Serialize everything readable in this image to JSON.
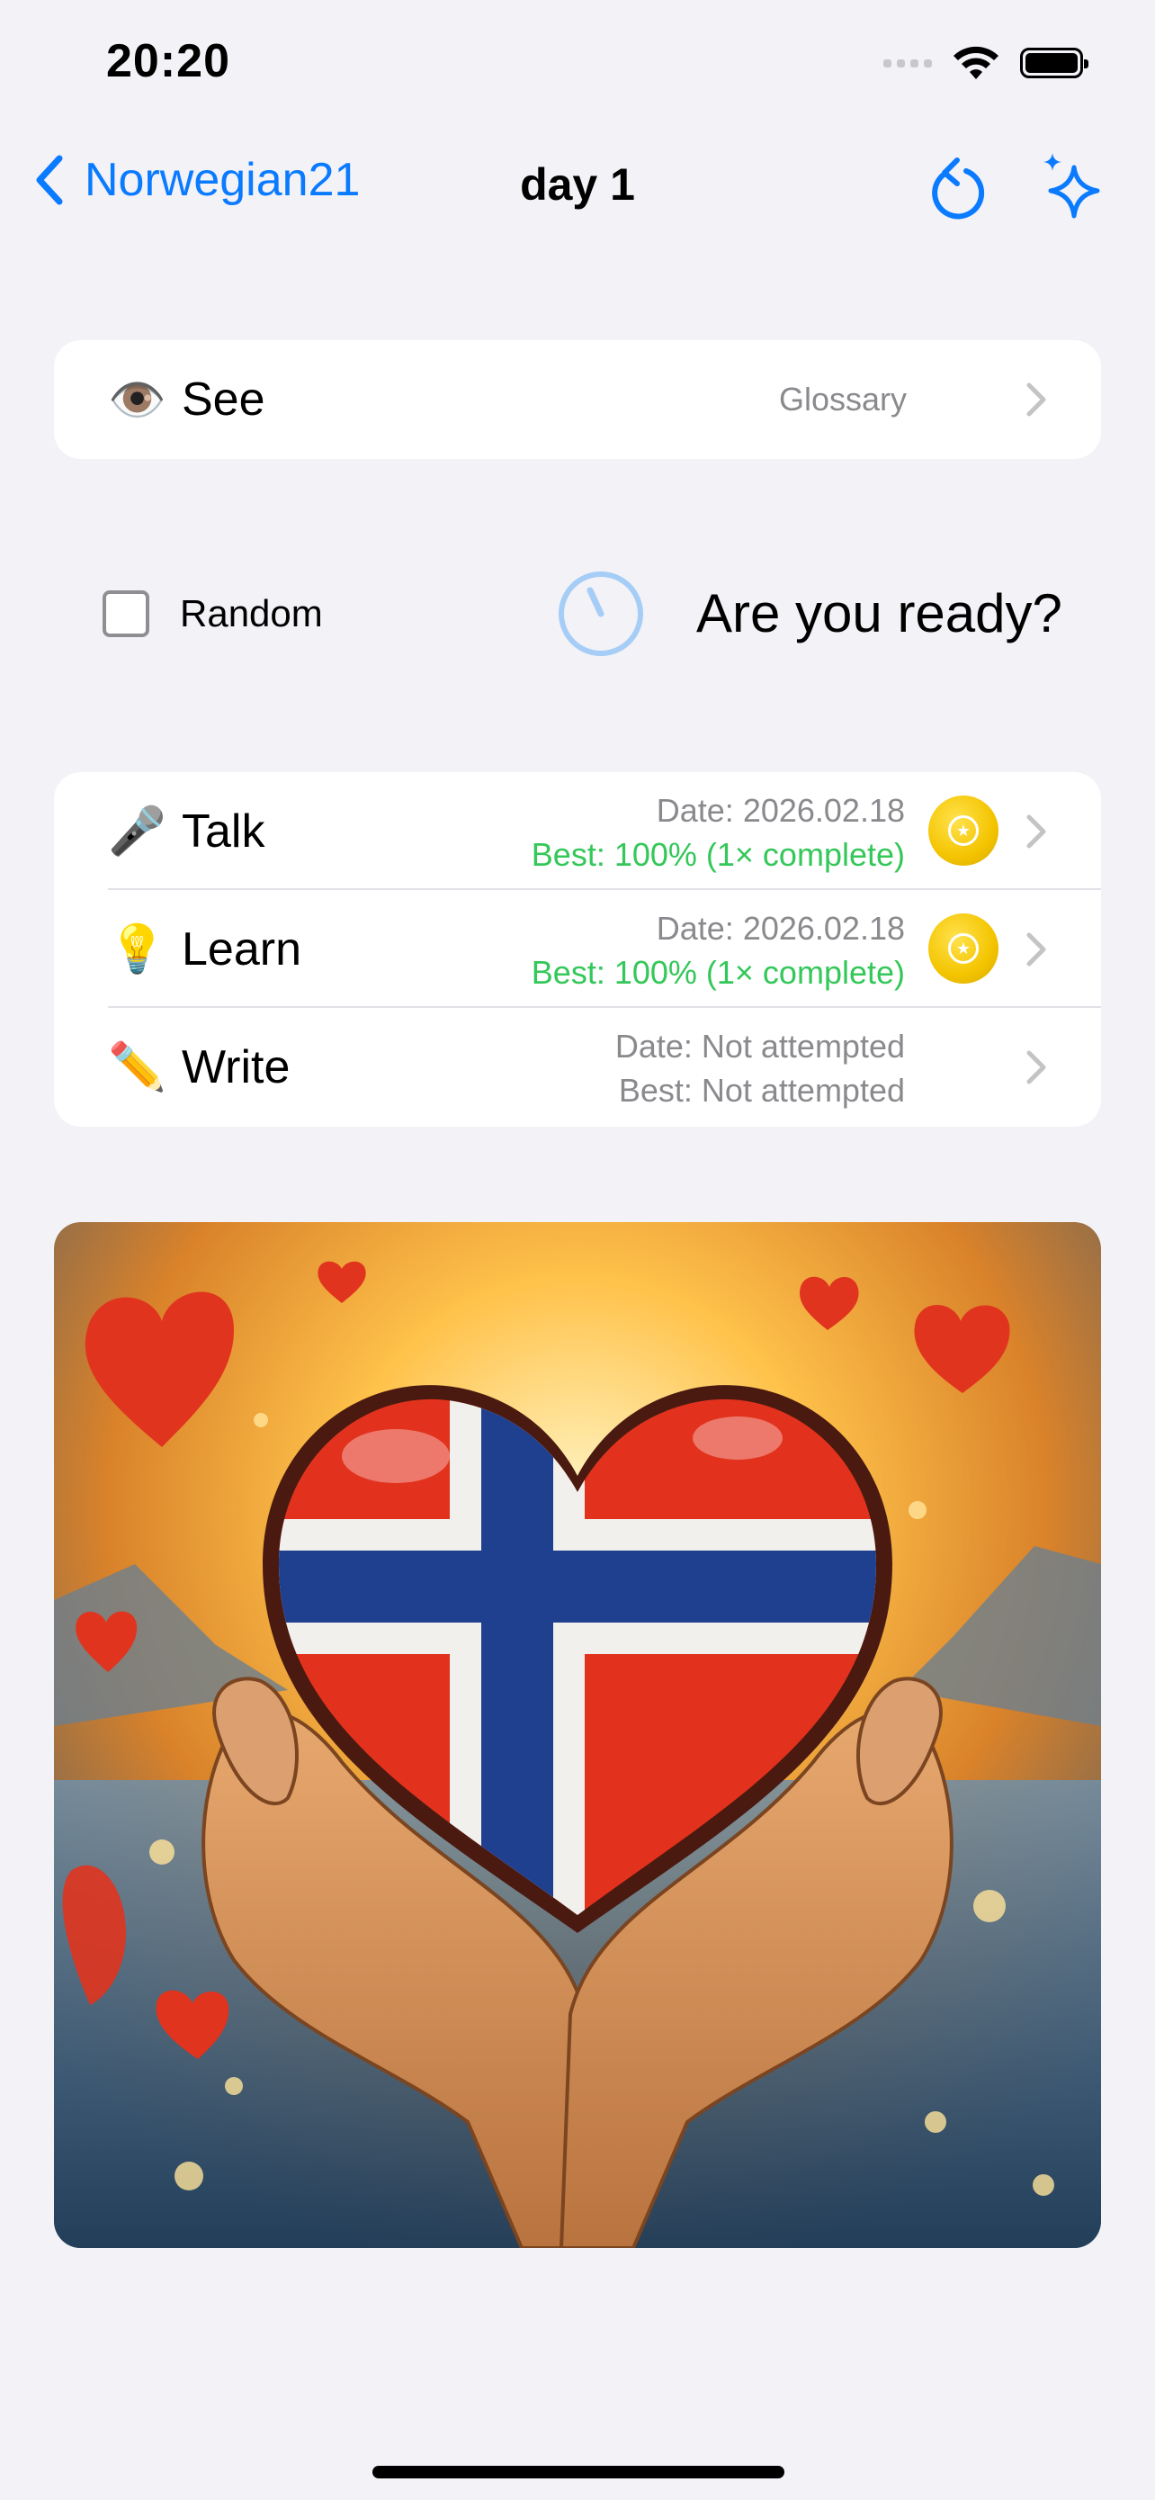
{
  "status_bar": {
    "time": "20:20"
  },
  "nav": {
    "back_label": "Norwegian21",
    "title": "day 1"
  },
  "see": {
    "emoji": "👁️",
    "label": "See",
    "detail": "Glossary"
  },
  "options": {
    "random_label": "Random",
    "ready_text": "Are you ready?"
  },
  "practice": [
    {
      "emoji": "🎤",
      "label": "Talk",
      "date": "Date: 2026.02.18",
      "best": "Best: 100% (1× complete)",
      "completed": true
    },
    {
      "emoji": "💡",
      "label": "Learn",
      "date": "Date: 2026.02.18",
      "best": "Best: 100% (1× complete)",
      "completed": true
    },
    {
      "emoji": "✏️",
      "label": "Write",
      "date": "Date: Not attempted",
      "best": "Best: Not attempted",
      "completed": false
    }
  ],
  "colors": {
    "accent": "#0a7aff",
    "success": "#34c759",
    "badge": "#f4c400",
    "background": "#f2f2f7"
  }
}
